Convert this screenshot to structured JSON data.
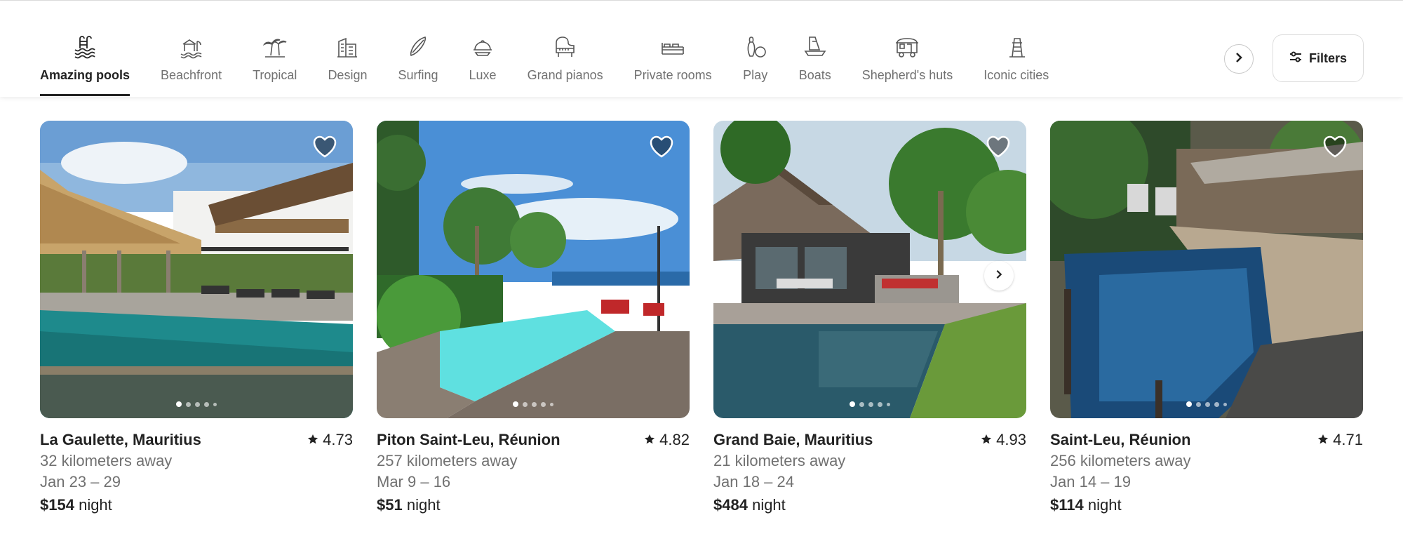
{
  "categories": [
    {
      "label": "Amazing pools",
      "icon": "pool-icon",
      "active": true
    },
    {
      "label": "Beachfront",
      "icon": "beachfront-icon",
      "active": false
    },
    {
      "label": "Tropical",
      "icon": "palm-tree-icon",
      "active": false
    },
    {
      "label": "Design",
      "icon": "design-building-icon",
      "active": false
    },
    {
      "label": "Surfing",
      "icon": "surfboard-icon",
      "active": false
    },
    {
      "label": "Luxe",
      "icon": "cloche-icon",
      "active": false
    },
    {
      "label": "Grand pianos",
      "icon": "grand-piano-icon",
      "active": false
    },
    {
      "label": "Private rooms",
      "icon": "bed-icon",
      "active": false
    },
    {
      "label": "Play",
      "icon": "bowling-icon",
      "active": false
    },
    {
      "label": "Boats",
      "icon": "boat-icon",
      "active": false
    },
    {
      "label": "Shepherd's huts",
      "icon": "hut-icon",
      "active": false
    },
    {
      "label": "Iconic cities",
      "icon": "tower-icon",
      "active": false
    }
  ],
  "filters": {
    "label": "Filters",
    "icon": "sliders-icon"
  },
  "nav": {
    "next_icon": "chevron-right-icon"
  },
  "listings": [
    {
      "location": "La Gaulette, Mauritius",
      "rating": "4.73",
      "distance": "32 kilometers away",
      "dates": "Jan 23 – 29",
      "price": "$154",
      "price_unit": "night"
    },
    {
      "location": "Piton Saint-Leu, Réunion",
      "rating": "4.82",
      "distance": "257 kilometers away",
      "dates": "Mar 9 – 16",
      "price": "$51",
      "price_unit": "night"
    },
    {
      "location": "Grand Baie, Mauritius",
      "rating": "4.93",
      "distance": "21 kilometers away",
      "dates": "Jan 18 – 24",
      "price": "$484",
      "price_unit": "night"
    },
    {
      "location": "Saint-Leu, Réunion",
      "rating": "4.71",
      "distance": "256 kilometers away",
      "dates": "Jan 14 – 19",
      "price": "$114",
      "price_unit": "night"
    }
  ],
  "colors": {
    "text": "#222222",
    "muted": "#717171",
    "border": "#dddddd"
  }
}
